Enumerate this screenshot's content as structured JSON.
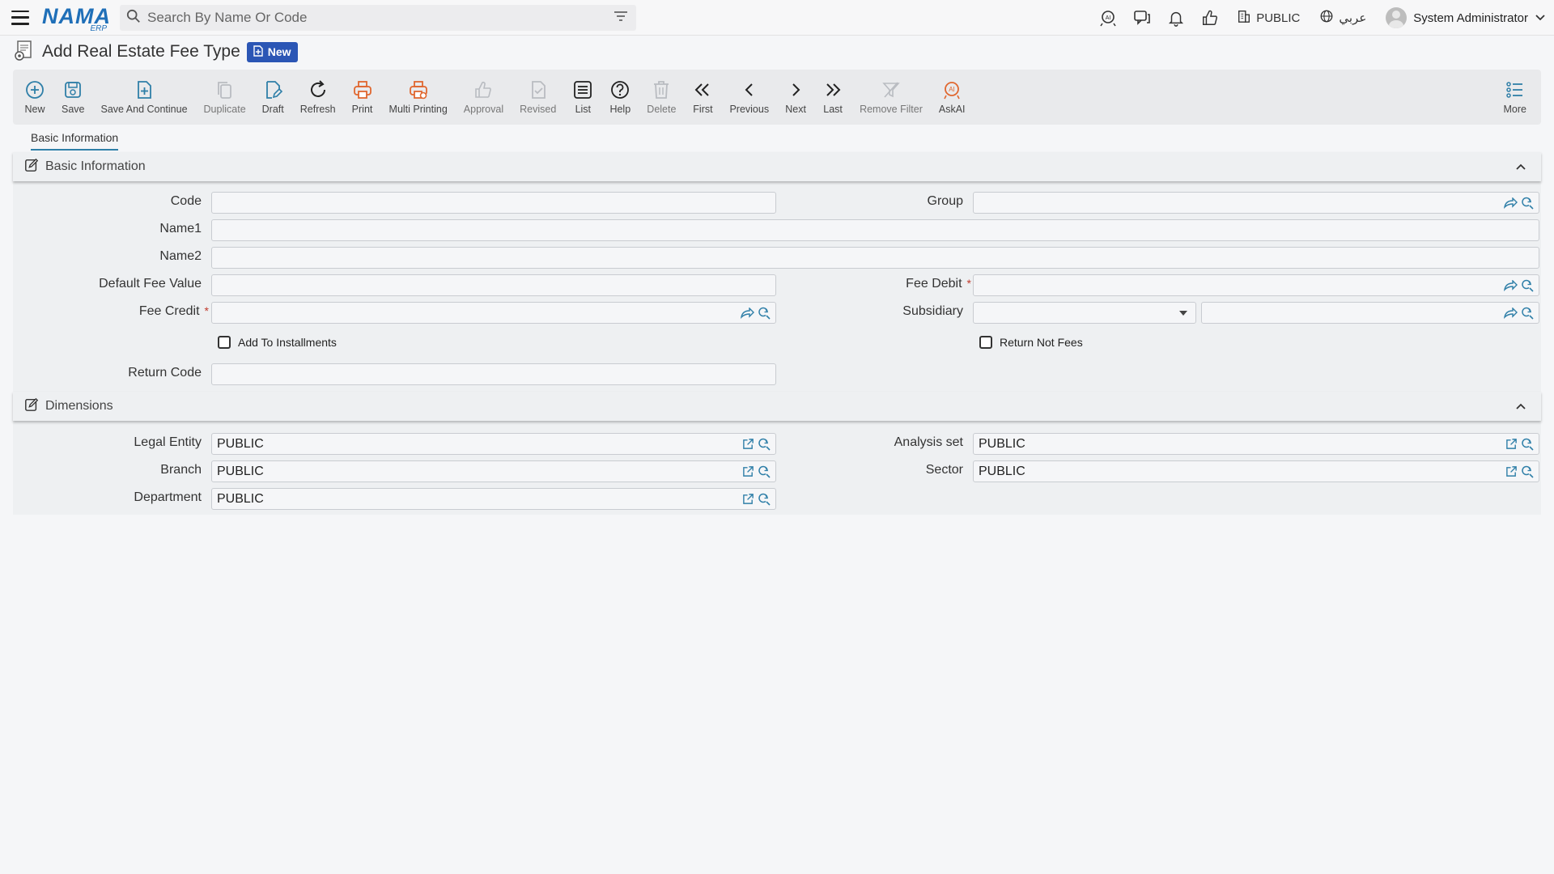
{
  "topbar": {
    "logo_text": "NAMA",
    "logo_sub": "ERP",
    "search_placeholder": "Search By Name Or Code",
    "company": "PUBLIC",
    "language": "عربي",
    "user": "System Administrator"
  },
  "page": {
    "title": "Add Real Estate Fee Type",
    "badge": "New"
  },
  "toolbar": {
    "new": "New",
    "save": "Save",
    "save_continue": "Save And Continue",
    "duplicate": "Duplicate",
    "draft": "Draft",
    "refresh": "Refresh",
    "print": "Print",
    "multi_printing": "Multi Printing",
    "approval": "Approval",
    "revised": "Revised",
    "list": "List",
    "help": "Help",
    "delete": "Delete",
    "first": "First",
    "previous": "Previous",
    "next": "Next",
    "last": "Last",
    "remove_filter": "Remove Filter",
    "askai": "AskAI",
    "more": "More"
  },
  "tabs": {
    "basic": "Basic Information"
  },
  "basic": {
    "header": "Basic Information",
    "code_label": "Code",
    "group_label": "Group",
    "name1_label": "Name1",
    "name2_label": "Name2",
    "default_fee_label": "Default Fee Value",
    "fee_debit_label": "Fee Debit",
    "fee_credit_label": "Fee Credit",
    "subsidiary_label": "Subsidiary",
    "required_mark": "*",
    "add_installments": "Add To Installments",
    "return_not_fees": "Return Not Fees",
    "return_code_label": "Return Code"
  },
  "dimensions": {
    "header": "Dimensions",
    "legal_entity_label": "Legal Entity",
    "legal_entity_value": "PUBLIC",
    "analysis_set_label": "Analysis set",
    "analysis_set_value": "PUBLIC",
    "branch_label": "Branch",
    "branch_value": "PUBLIC",
    "sector_label": "Sector",
    "sector_value": "PUBLIC",
    "department_label": "Department",
    "department_value": "PUBLIC"
  },
  "colors": {
    "accent": "#2f7fa8",
    "brand": "#1f6fb8",
    "badge": "#2b56b5",
    "orange": "#e0672f",
    "required": "#c0392b"
  }
}
